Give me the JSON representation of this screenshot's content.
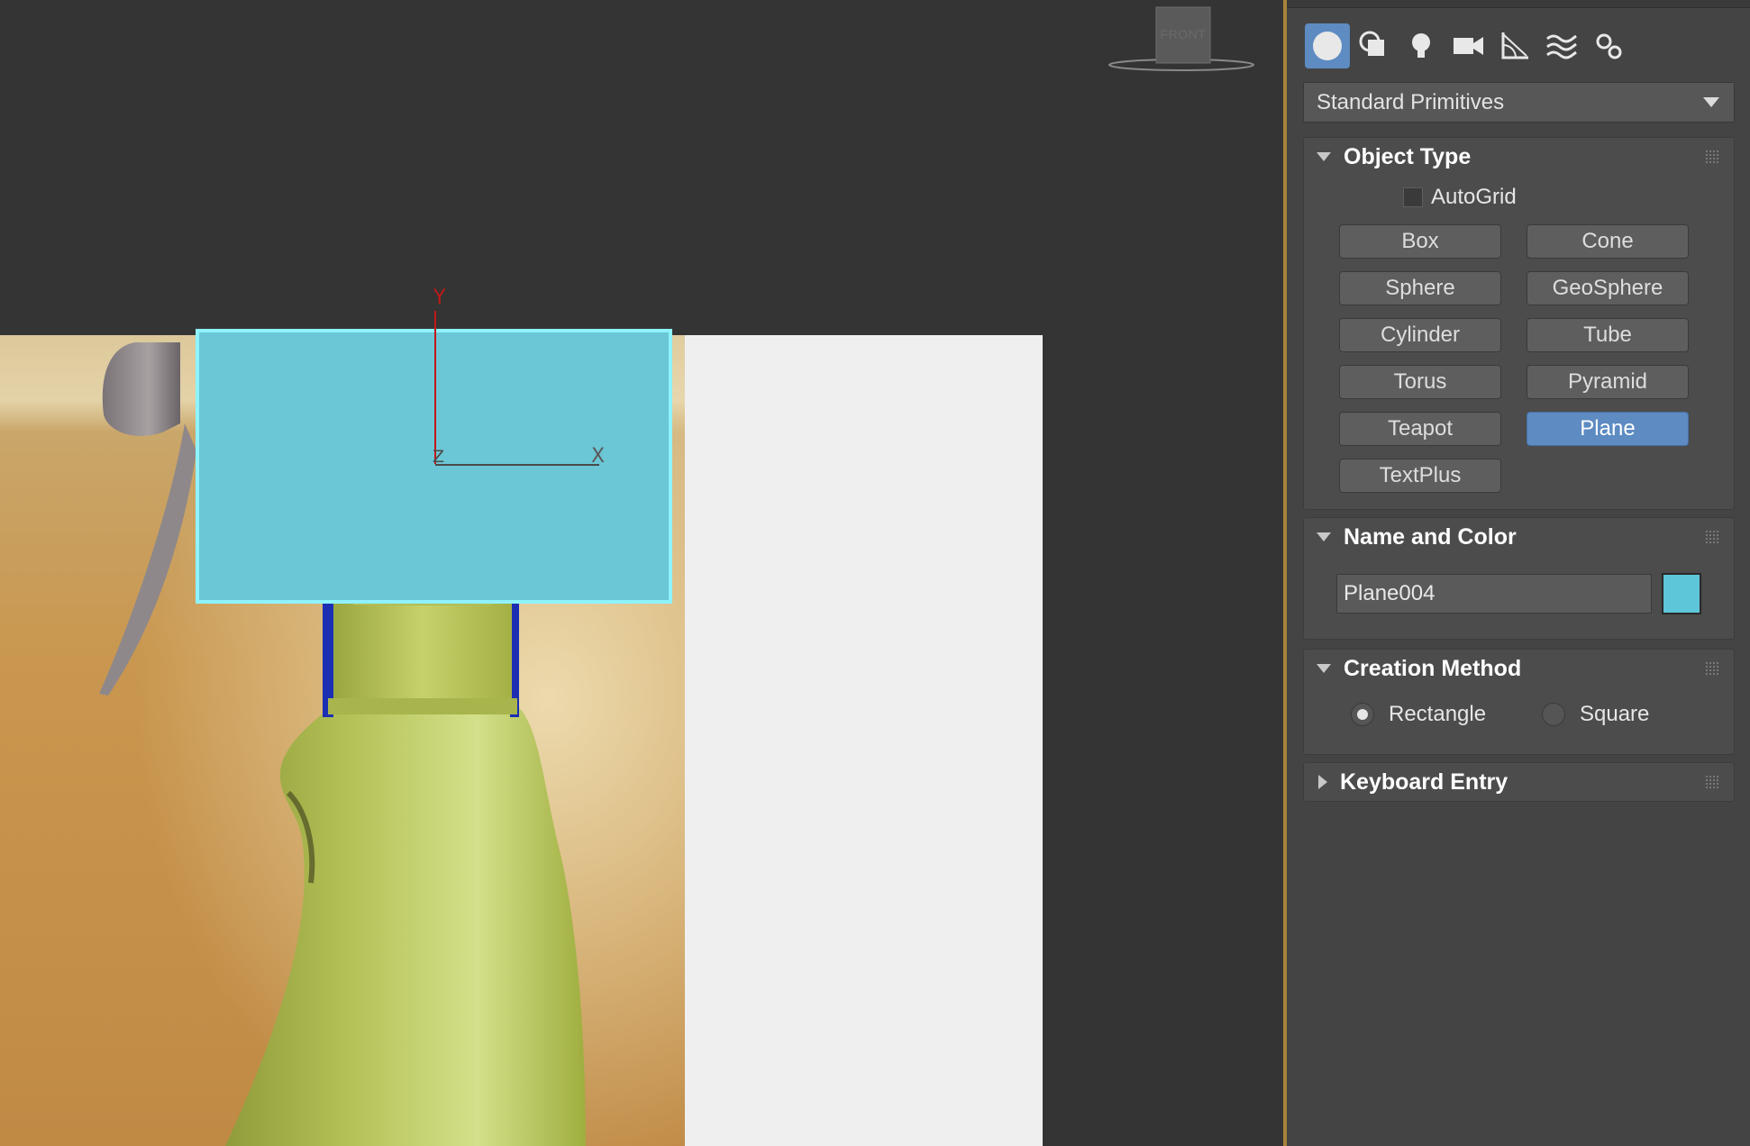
{
  "viewport": {
    "viewcube_label": "FRONT",
    "axis_labels": {
      "y": "Y",
      "z": "Z",
      "x": "X"
    },
    "selected_color": "#6bc6d6"
  },
  "panel": {
    "category_icons": [
      "geometry-icon",
      "shapes-icon",
      "lights-icon",
      "cameras-icon",
      "helpers-icon",
      "spacewarps-icon",
      "systems-icon"
    ],
    "active_category": "geometry-icon",
    "dropdown": {
      "selected": "Standard Primitives"
    },
    "object_type": {
      "title": "Object Type",
      "autogrid_label": "AutoGrid",
      "autogrid_checked": false,
      "buttons": [
        "Box",
        "Cone",
        "Sphere",
        "GeoSphere",
        "Cylinder",
        "Tube",
        "Torus",
        "Pyramid",
        "Teapot",
        "Plane",
        "TextPlus"
      ],
      "active_button": "Plane"
    },
    "name_and_color": {
      "title": "Name and Color",
      "name_value": "Plane004",
      "color": "#5ec6d9"
    },
    "creation_method": {
      "title": "Creation Method",
      "options": [
        "Rectangle",
        "Square"
      ],
      "selected": "Rectangle"
    },
    "keyboard_entry": {
      "title": "Keyboard Entry"
    }
  },
  "colors": {
    "accent": "#5d8bc2",
    "divider": "#a9823a"
  }
}
